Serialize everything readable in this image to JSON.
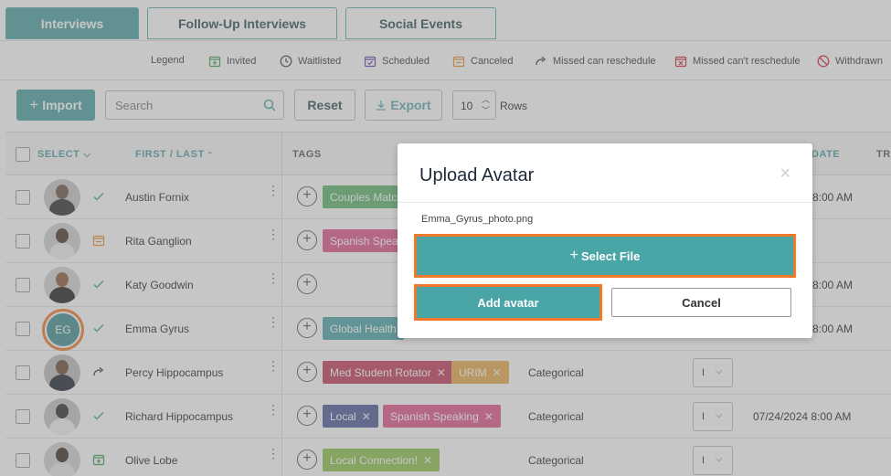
{
  "tabs": [
    {
      "label": "Interviews",
      "active": true
    },
    {
      "label": "Follow-Up Interviews",
      "active": false
    },
    {
      "label": "Social Events",
      "active": false
    }
  ],
  "legend": {
    "title": "Legend",
    "items": [
      {
        "label": "Invited",
        "icon": "calendar-plus-icon",
        "color": "#3a9a4a"
      },
      {
        "label": "Waitlisted",
        "icon": "clock-icon",
        "color": "#333333"
      },
      {
        "label": "Scheduled",
        "icon": "calendar-check-icon",
        "color": "#6a3ab0"
      },
      {
        "label": "Canceled",
        "icon": "calendar-icon",
        "color": "#e88a2a"
      },
      {
        "label": "Missed can reschedule",
        "icon": "redo-arrow-icon",
        "color": "#333333"
      },
      {
        "label": "Missed can't reschedule",
        "icon": "calendar-x-icon",
        "color": "#cc2233"
      },
      {
        "label": "Withdrawn",
        "icon": "ban-icon",
        "color": "#cc2233"
      }
    ]
  },
  "toolbar": {
    "import_label": "Import",
    "search_placeholder": "Search",
    "reset_label": "Reset",
    "export_label": "Export",
    "rows_value": "10",
    "rows_label": "Rows"
  },
  "table": {
    "headers": {
      "select": "SELECT",
      "first_last": "FIRST / LAST",
      "tags": "TAGS",
      "date": "DATE",
      "tra": "TRA"
    },
    "rows": [
      {
        "name": "Austin Fornix",
        "status": "check",
        "tags": [
          {
            "label": "Couples Match",
            "color": "#5ab36a"
          }
        ],
        "category": "",
        "dd": "",
        "date": "8:00 AM"
      },
      {
        "name": "Rita Ganglion",
        "status": "calendar",
        "tags": [
          {
            "label": "Spanish Speak",
            "color": "#e0558a"
          }
        ],
        "category": "",
        "dd": "",
        "date": ""
      },
      {
        "name": "Katy Goodwin",
        "status": "check",
        "tags": [],
        "category": "",
        "dd": "",
        "date": "8:00 AM"
      },
      {
        "name": "Emma Gyrus",
        "status": "check",
        "initials": "EG",
        "tags": [
          {
            "label": "Global Health",
            "color": "#4aa5a6"
          }
        ],
        "category": "",
        "dd": "",
        "date": "8:00 AM"
      },
      {
        "name": "Percy Hippocampus",
        "status": "redo",
        "tags": [
          {
            "label": "Med Student Rotator",
            "color": "#c23b5a"
          },
          {
            "label": "URIM",
            "color": "#e8a94a"
          }
        ],
        "category": "Categorical",
        "dd": "I",
        "date": ""
      },
      {
        "name": "Richard Hippocampus",
        "status": "check",
        "tags": [
          {
            "label": "Local",
            "color": "#4a5a9a"
          },
          {
            "label": "Spanish Speaking",
            "color": "#e0558a"
          }
        ],
        "category": "Categorical",
        "dd": "I",
        "date": "07/24/2024 8:00 AM"
      },
      {
        "name": "Olive Lobe",
        "status": "calendar-plus",
        "tags": [
          {
            "label": "Local Connection!",
            "color": "#8ac24a"
          }
        ],
        "category": "Categorical",
        "dd": "I",
        "date": ""
      }
    ]
  },
  "modal": {
    "title": "Upload Avatar",
    "close": "×",
    "filename": "Emma_Gyrus_photo.png",
    "select_file_label": "Select File",
    "add_avatar_label": "Add avatar",
    "cancel_label": "Cancel"
  },
  "colors": {
    "primary": "#4a9fa0",
    "highlight": "#f07a2a"
  }
}
